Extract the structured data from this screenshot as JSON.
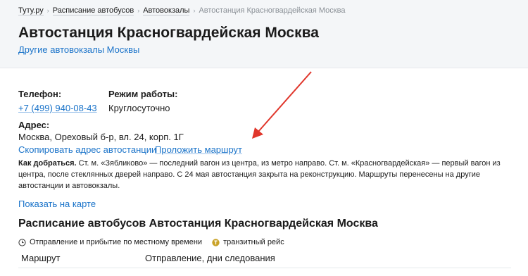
{
  "breadcrumb": {
    "items": [
      "Туту.ру",
      "Расписание автобусов",
      "Автовокзалы"
    ],
    "current": "Автостанция Красногвардейская Москва",
    "separator": "›"
  },
  "page": {
    "title": "Автостанция Красногвардейская Москва",
    "other_stations_link": "Другие автовокзалы Москвы"
  },
  "contacts": {
    "phone_label": "Телефон:",
    "phone_value": "+7 (499) 940-08-43",
    "hours_label": "Режим работы:",
    "hours_value": "Круглосуточно",
    "address_label": "Адрес:",
    "address_value": "Москва, Ореховый б-р, вл. 24, корп. 1Г",
    "copy_address_link": "Скопировать адрес автостанции",
    "route_link": "Проложить маршрут"
  },
  "directions": {
    "label": "Как добраться.",
    "text": "Ст. м. «Зябликово» — последний вагон из центра, из метро направо. Ст. м. «Красногвардейская» — первый вагон из центра, после стеклянных дверей направо. С 24 мая автостанция закрыта на реконструкцию. Маршруты перенесены на другие автостанции и автовокзалы."
  },
  "map": {
    "show_link": "Показать на карте"
  },
  "schedule": {
    "title": "Расписание автобусов Автостанция Красногвардейская Москва",
    "legend_local_time": "Отправление и прибытие по местному времени",
    "legend_transit": "транзитный рейс",
    "columns": [
      "Маршрут",
      "Отправление, дни следования"
    ]
  },
  "colors": {
    "link": "#1a73c9",
    "header_bg": "#f4f6f8",
    "annotation_arrow": "#e0362b",
    "transit_icon": "#c9a227"
  },
  "icons": {
    "clock": "clock-icon",
    "transit": "transit-icon",
    "annotation": "red-arrow-annotation"
  }
}
